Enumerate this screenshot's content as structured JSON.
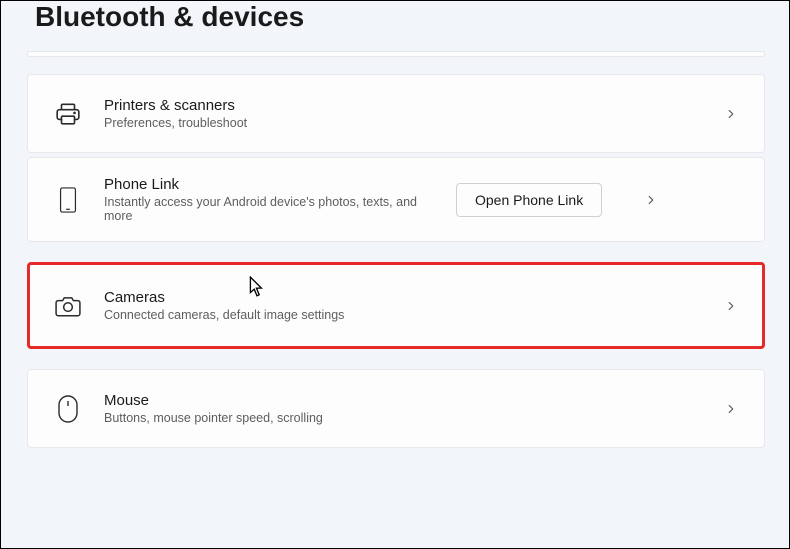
{
  "pageTitle": "Bluetooth & devices",
  "cards": [
    {
      "title": "Printers & scanners",
      "subtitle": "Preferences, troubleshoot"
    },
    {
      "title": "Phone Link",
      "subtitle": "Instantly access your Android device's photos, texts, and more",
      "button": "Open Phone Link"
    },
    {
      "title": "Cameras",
      "subtitle": "Connected cameras, default image settings"
    },
    {
      "title": "Mouse",
      "subtitle": "Buttons, mouse pointer speed, scrolling"
    }
  ]
}
